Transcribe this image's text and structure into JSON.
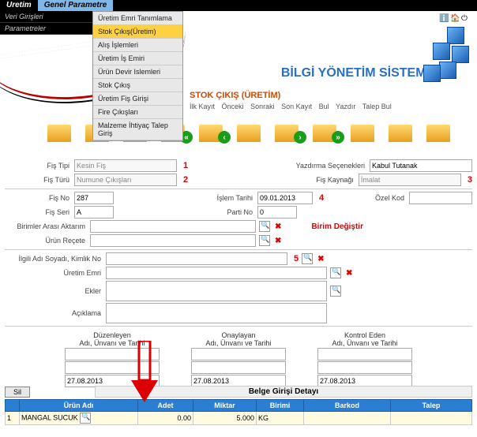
{
  "top": {
    "tab1": "Uretim",
    "tab2": "Genel Parametre"
  },
  "side": {
    "i1": "Veri Girişleri",
    "i2": "Parametreler"
  },
  "menu": {
    "items": [
      "Üretim Emri Tanımlama",
      "Stok Çıkış(Üretim)",
      "Alış İşlemleri",
      "Üretim İş Emiri",
      "Ürün Devir Islemleri",
      "Stok Çıkış",
      "Üretim Fiş Girişi",
      "Fire Çıkışları",
      "Malzeme İhtiyaç Talep Giriş"
    ]
  },
  "brand": "BİLGİ YÖNETİM SİSTEMİ",
  "subtitle": "STOK ÇIKIŞ (ÜRETİM)",
  "nav": {
    "a": "İlk Kayıt",
    "b": "Önceki",
    "c": "Sonraki",
    "d": "Son Kayıt",
    "e": "Bul",
    "f": "Yazdır",
    "g": "Talep Bul"
  },
  "labels": {
    "fistipi": "Fiş Tipi",
    "fisturu": "Fiş Türü",
    "fisno": "Fiş No",
    "fisseri": "Fiş Seri",
    "birimler": "Birimler Arası Aktarım",
    "urunrecete": "Ürün Reçete",
    "ilgili": "İlgili Adı Soyadı, Kimlik No",
    "uretimemri": "Üretim Emri",
    "ekler": "Ekler",
    "aciklama": "Açıklama",
    "yazdirma": "Yazdırma Seçenekleri",
    "fiskaynagi": "Fiş Kaynağı",
    "islemtarihi": "İşlem Tarihi",
    "partino": "Parti No",
    "ozelkod": "Özel Kod",
    "birimdeg": "Birim Değiştir",
    "duz": "Düzenleyen",
    "ona": "Onaylayan",
    "kon": "Kontrol Eden",
    "adt": "Adı, Ünvanı ve Tarihi",
    "sil": "Sil",
    "belge": "Belge Girişi Detayı"
  },
  "vals": {
    "fistipi": "Kesin Fiş",
    "fisturu": "Numune Çıkışları",
    "fisno": "287",
    "fisseri": "A",
    "yazdirma": "Kabul Tutanak",
    "fiskaynagi": "İmalat",
    "islemtarihi": "09.01.2013",
    "partino": "0",
    "sigdate": "27.08.2013"
  },
  "nums": {
    "n1": "1",
    "n2": "2",
    "n3": "3",
    "n4": "4",
    "n5": "5"
  },
  "thead": {
    "c0": "",
    "c1": "Ürün Adı",
    "c2": "Adet",
    "c3": "Miktar",
    "c4": "Birimi",
    "c5": "Barkod",
    "c6": "Talep"
  },
  "trow": {
    "idx": "1",
    "name": "MANGAL SUCUK",
    "adet": "0.00",
    "miktar": "5.000",
    "birim": "KG",
    "barkod": "",
    "talep": ""
  }
}
